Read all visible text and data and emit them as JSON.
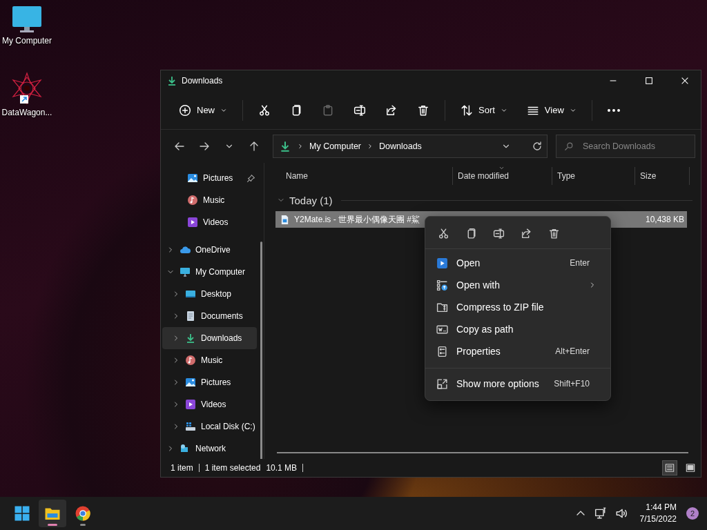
{
  "desktop_icons": [
    {
      "label": "My Computer",
      "kind": "computer"
    },
    {
      "label": "DataWagon...",
      "kind": "shortcut"
    }
  ],
  "window": {
    "title": "Downloads",
    "toolbar": [
      {
        "kind": "new",
        "label": "New",
        "disabled": false
      },
      {
        "kind": "cut",
        "disabled": false
      },
      {
        "kind": "copy",
        "disabled": false
      },
      {
        "kind": "paste",
        "disabled": true
      },
      {
        "kind": "rename",
        "disabled": false
      },
      {
        "kind": "share",
        "disabled": false
      },
      {
        "kind": "delete",
        "disabled": false
      },
      {
        "kind": "sort",
        "label": "Sort",
        "disabled": false
      },
      {
        "kind": "view",
        "label": "View",
        "disabled": false
      },
      {
        "kind": "more",
        "disabled": false
      }
    ],
    "address": {
      "path": [
        "My Computer",
        "Downloads"
      ]
    },
    "search": {
      "placeholder": "Search Downloads"
    },
    "sidebar": {
      "quick_access": [
        {
          "kind": "pictures",
          "label": "Pictures",
          "pinned": true,
          "selected": false
        },
        {
          "kind": "music",
          "label": "Music",
          "pinned": false,
          "selected": false
        },
        {
          "kind": "videos",
          "label": "Videos",
          "pinned": false,
          "selected": false
        }
      ],
      "tree": [
        {
          "kind": "cloud",
          "label": "OneDrive",
          "expanded": false,
          "selected": false
        },
        {
          "kind": "computer",
          "label": "My Computer",
          "expanded": true,
          "selected": false,
          "children": [
            {
              "kind": "desktop",
              "label": "Desktop",
              "expanded": false,
              "selected": false
            },
            {
              "kind": "documents",
              "label": "Documents",
              "expanded": false,
              "selected": false
            },
            {
              "kind": "download",
              "label": "Downloads",
              "expanded": false,
              "selected": true
            },
            {
              "kind": "music",
              "label": "Music",
              "expanded": false,
              "selected": false
            },
            {
              "kind": "pictures",
              "label": "Pictures",
              "expanded": false,
              "selected": false
            },
            {
              "kind": "videos",
              "label": "Videos",
              "expanded": false,
              "selected": false
            },
            {
              "kind": "disk",
              "label": "Local Disk (C:)",
              "expanded": false,
              "selected": false
            }
          ]
        },
        {
          "kind": "network",
          "label": "Network",
          "expanded": false,
          "selected": false
        }
      ]
    },
    "columns": [
      {
        "label": "Name",
        "sorted": false
      },
      {
        "label": "Date modified",
        "sorted": true
      },
      {
        "label": "Type",
        "sorted": false
      },
      {
        "label": "Size",
        "sorted": false
      }
    ],
    "groups": [
      {
        "label": "Today (1)",
        "expanded": true,
        "rows": [
          {
            "name": "Y2Mate.is - 世界最小偶像天團 #鯊",
            "size": "10,438 KB",
            "selected": true
          }
        ]
      }
    ],
    "status_bar": {
      "count": "1 item",
      "selection": "1 item selected",
      "size": "10.1 MB"
    },
    "view_modes": [
      {
        "kind": "details",
        "selected": true
      },
      {
        "kind": "tiles",
        "selected": false
      }
    ]
  },
  "context_menu": {
    "actions": [
      {
        "kind": "cut"
      },
      {
        "kind": "copy"
      },
      {
        "kind": "rename"
      },
      {
        "kind": "share"
      },
      {
        "kind": "delete"
      }
    ],
    "items": [
      {
        "kind": "open",
        "label": "Open",
        "shortcut": "Enter",
        "submenu": false
      },
      {
        "kind": "open-with",
        "label": "Open with",
        "submenu": true
      },
      {
        "kind": "zip",
        "label": "Compress to ZIP file",
        "submenu": false
      },
      {
        "kind": "copy-path",
        "label": "Copy as path",
        "submenu": false
      },
      {
        "kind": "properties",
        "label": "Properties",
        "shortcut": "Alt+Enter",
        "submenu": false
      }
    ],
    "footer": {
      "kind": "more-options",
      "label": "Show more options",
      "shortcut": "Shift+F10"
    }
  },
  "taskbar": {
    "apps": [
      {
        "kind": "start",
        "running": false,
        "active": false
      },
      {
        "kind": "explorer",
        "running": true,
        "active": true
      },
      {
        "kind": "chrome",
        "running": true,
        "active": false
      }
    ],
    "time": "1:44 PM",
    "date": "7/15/2022",
    "notifications": "2"
  }
}
